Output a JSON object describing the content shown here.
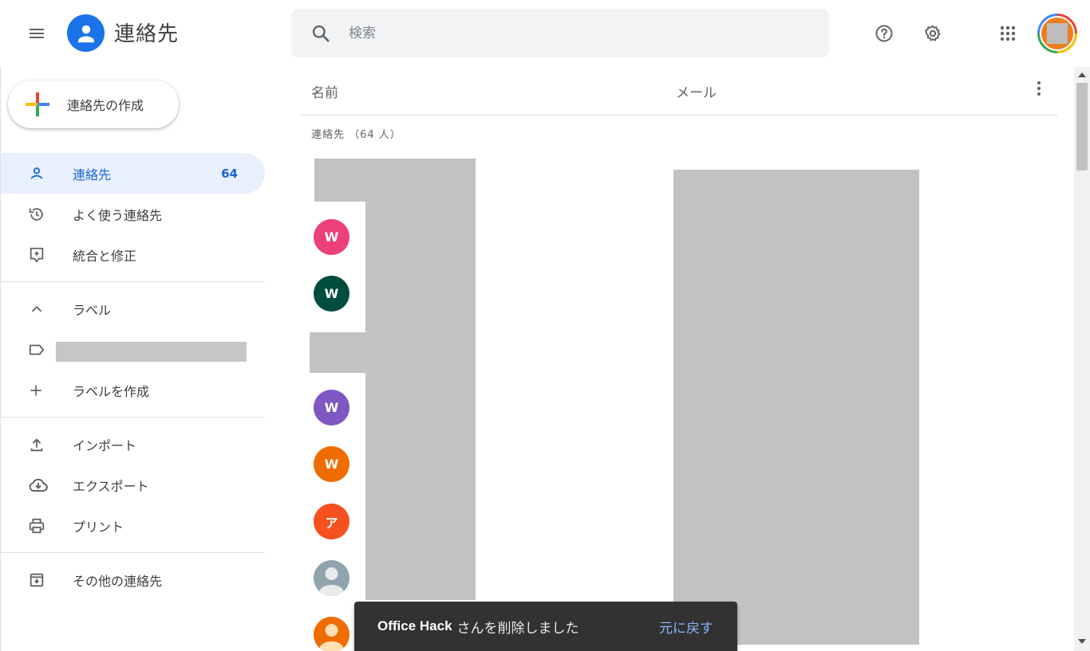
{
  "header": {
    "app_title": "連絡先",
    "search_placeholder": "検索"
  },
  "sidebar": {
    "create_label": "連絡先の作成",
    "items": [
      {
        "label": "連絡先",
        "count": "64",
        "icon": "person-icon",
        "active": true
      },
      {
        "label": "よく使う連絡先",
        "icon": "history-icon"
      },
      {
        "label": "統合と修正",
        "icon": "merge-fix-icon"
      }
    ],
    "labels_header": "ラベル",
    "create_label_item": "ラベルを作成",
    "tools": [
      {
        "label": "インポート",
        "icon": "upload-icon"
      },
      {
        "label": "エクスポート",
        "icon": "cloud-download-icon"
      },
      {
        "label": "プリント",
        "icon": "printer-icon"
      }
    ],
    "other_contacts": "その他の連絡先"
  },
  "main": {
    "col_name": "名前",
    "col_email": "メール",
    "count_title": "連絡先 （64 人）",
    "contacts": [
      {
        "initial": "W",
        "color": "#ec407a"
      },
      {
        "initial": "W",
        "color": "#004d40"
      },
      {
        "initial": "W",
        "color": "#7e57c2"
      },
      {
        "initial": "W",
        "color": "#ef6c00"
      },
      {
        "initial": "ア",
        "color": "#f4511e"
      },
      {
        "initial": "",
        "color": "#90a4ae"
      },
      {
        "initial": "",
        "color": "#ef6c00"
      }
    ]
  },
  "snackbar": {
    "name": "Office Hack",
    "message": "さんを削除しました",
    "action": "元に戻す"
  },
  "colors": {
    "accent": "#1a73e8",
    "active_bg": "#e8f0fe",
    "snackbar_bg": "#323232"
  }
}
